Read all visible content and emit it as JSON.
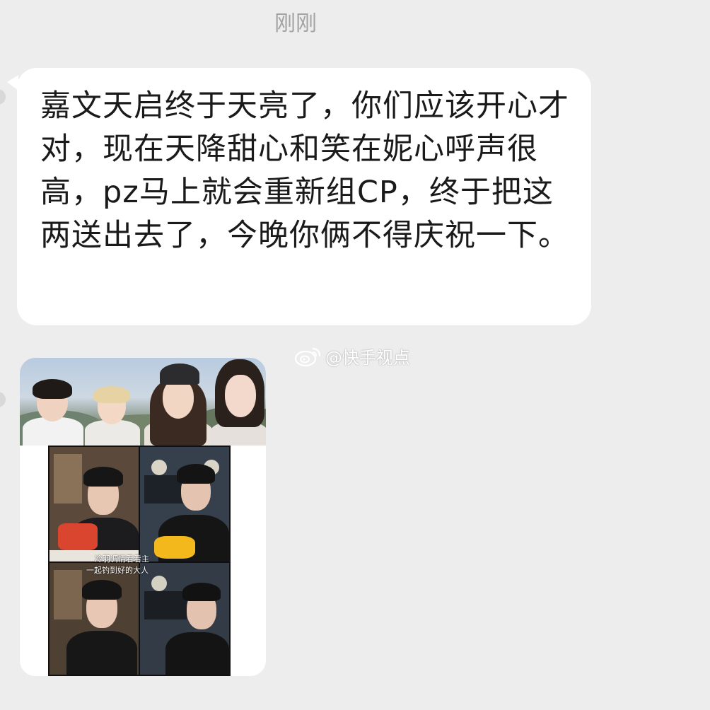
{
  "chat": {
    "timestamp": "刚刚",
    "message": {
      "text": "嘉文天启终于天亮了，你们应该开心才对，现在天降甜心和笑在妮心呼声很高，pz马上就会重新组CP，终于把这两送出去了，今晚你俩不得庆祝一下。"
    },
    "watermark": "@快手视点",
    "image_caption_line1": "冷羽调情看看主",
    "image_caption_line2": "一起钓到好的大人"
  },
  "colors": {
    "background": "#ededed",
    "bubble": "#ffffff",
    "text": "#1a1a1a",
    "timestamp": "#a3a3a3"
  }
}
